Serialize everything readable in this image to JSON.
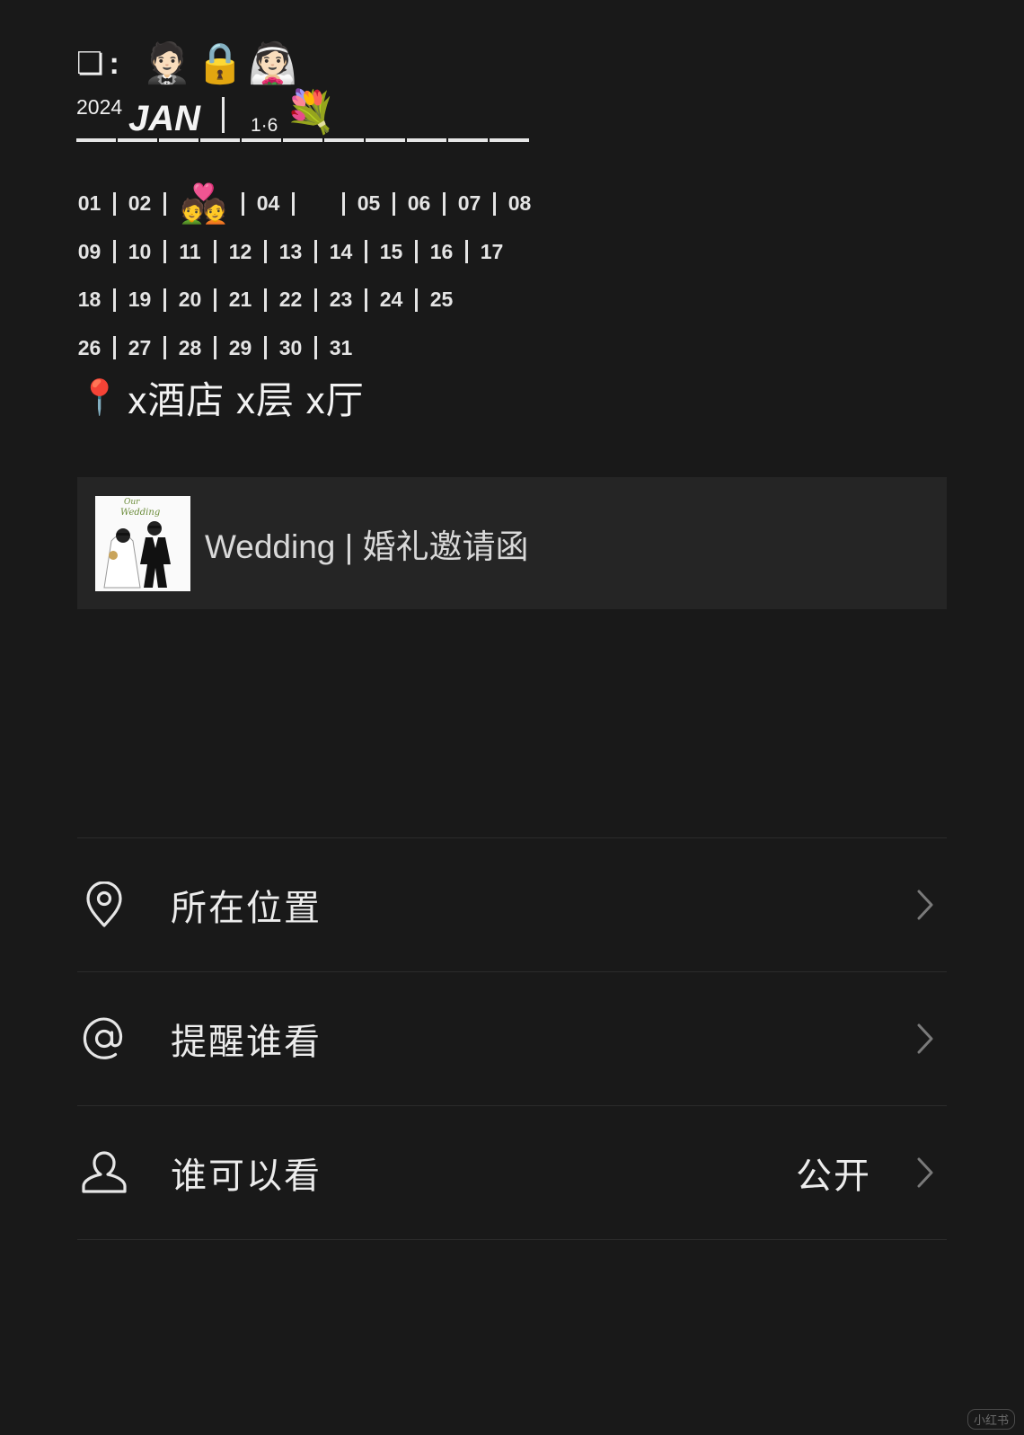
{
  "post": {
    "line1": {
      "glyph": "❏",
      "colon": ":",
      "emojis": [
        "🤵🏻",
        "🔒",
        "👰🏻"
      ]
    },
    "line2": {
      "year": "2024",
      "month": "JAN",
      "date": "1·6",
      "emoji": "💐"
    },
    "calendar": {
      "rows": [
        [
          "01",
          "02",
          "💑",
          "04",
          "",
          "05",
          "06",
          "07",
          "08"
        ],
        [
          "09",
          "10",
          "11",
          "12",
          "13",
          "14",
          "15",
          "16",
          "17"
        ],
        [
          "18",
          "19",
          "20",
          "21",
          "22",
          "23",
          "24",
          "25"
        ],
        [
          "26",
          "27",
          "28",
          "29",
          "30",
          "31"
        ]
      ]
    },
    "location": {
      "emoji": "📍",
      "text": "x酒店 x层 x厅"
    }
  },
  "share_card": {
    "title": "Wedding | 婚礼邀请函",
    "thumb_text": "Our Wedding"
  },
  "menu": [
    {
      "icon": "location-pin-icon",
      "label": "所在位置",
      "value": ""
    },
    {
      "icon": "at-sign-icon",
      "label": "提醒谁看",
      "value": ""
    },
    {
      "icon": "person-icon",
      "label": "谁可以看",
      "value": "公开"
    }
  ],
  "watermark": "小红书"
}
